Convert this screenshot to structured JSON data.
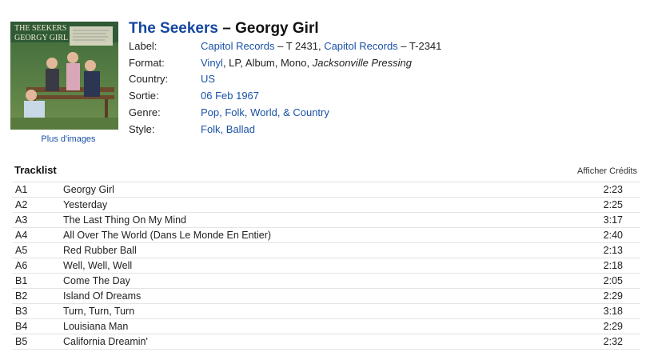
{
  "release": {
    "artist": "The Seekers",
    "separator": " – ",
    "title": "Georgy Girl",
    "cover_text": [
      "THE SEEKERS",
      "GEORGY GIRL"
    ],
    "more_images": "Plus d'images"
  },
  "info": {
    "label": {
      "key": "Label:",
      "link1": "Capitol Records",
      "cat1": " – T 2431, ",
      "link2": "Capitol Records",
      "cat2": " – T-2341"
    },
    "format": {
      "key": "Format:",
      "link": "Vinyl",
      "rest": ", LP, Album, Mono, ",
      "italic": "Jacksonville Pressing"
    },
    "country": {
      "key": "Country:",
      "value": "US"
    },
    "released": {
      "key": "Sortie:",
      "value": "06 Feb 1967"
    },
    "genre": {
      "key": "Genre:",
      "value": "Pop, Folk, World, & Country"
    },
    "style": {
      "key": "Style:",
      "value": "Folk, Ballad"
    }
  },
  "tracklist": {
    "heading": "Tracklist",
    "credits_toggle": "Afficher Crédits",
    "tracks": [
      {
        "pos": "A1",
        "title": "Georgy Girl",
        "duration": "2:23"
      },
      {
        "pos": "A2",
        "title": "Yesterday",
        "duration": "2:25"
      },
      {
        "pos": "A3",
        "title": "The Last Thing On My Mind",
        "duration": "3:17"
      },
      {
        "pos": "A4",
        "title": "All Over The World (Dans Le Monde En Entier)",
        "duration": "2:40"
      },
      {
        "pos": "A5",
        "title": "Red Rubber Ball",
        "duration": "2:13"
      },
      {
        "pos": "A6",
        "title": "Well, Well, Well",
        "duration": "2:18"
      },
      {
        "pos": "B1",
        "title": "Come The Day",
        "duration": "2:05"
      },
      {
        "pos": "B2",
        "title": "Island Of Dreams",
        "duration": "2:29"
      },
      {
        "pos": "B3",
        "title": "Turn, Turn, Turn",
        "duration": "3:18"
      },
      {
        "pos": "B4",
        "title": "Louisiana Man",
        "duration": "2:29"
      },
      {
        "pos": "B5",
        "title": "California Dreamin'",
        "duration": "2:32"
      }
    ]
  },
  "colors": {
    "link": "#1a52a6",
    "artist": "#1446a0",
    "divider": "#e4e4e4"
  }
}
